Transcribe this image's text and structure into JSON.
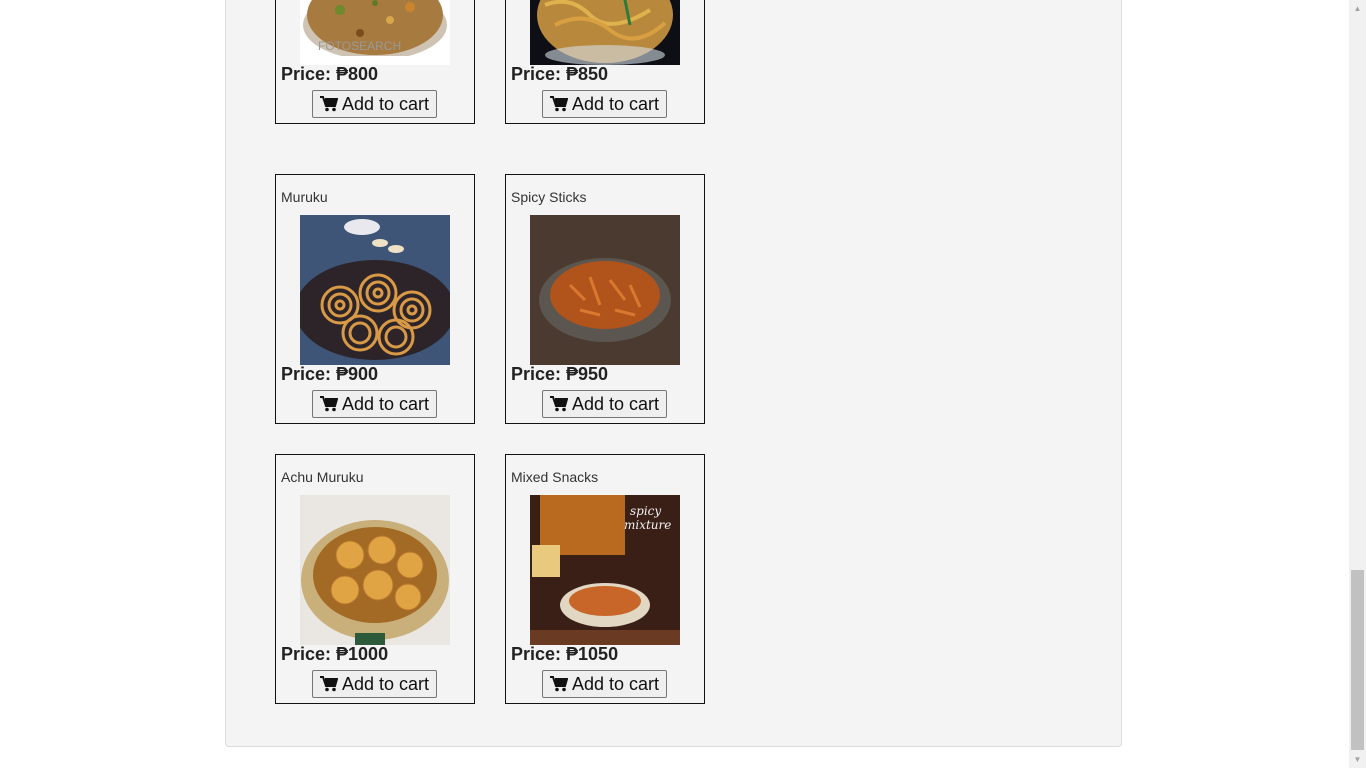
{
  "products": [
    {
      "name": "",
      "price": "Price: ₱800",
      "button": "Add to cart",
      "image": "mixture-bowl-photo"
    },
    {
      "name": "",
      "price": "Price: ₱850",
      "button": "Add to cart",
      "image": "noodle-snack-bowl-photo"
    },
    {
      "name": "Muruku",
      "price": "Price: ₱900",
      "button": "Add to cart",
      "image": "muruku-photo"
    },
    {
      "name": "Spicy Sticks",
      "price": "Price: ₱950",
      "button": "Add to cart",
      "image": "spicy-sticks-photo"
    },
    {
      "name": "Achu Muruku",
      "price": "Price: ₱1000",
      "button": "Add to cart",
      "image": "achu-muruku-photo"
    },
    {
      "name": "Mixed Snacks",
      "price": "Price: ₱1050",
      "button": "Add to cart",
      "image": "mixed-snacks-photo",
      "image_caption": "spicy mixture"
    }
  ],
  "watermark": "FOTOSEARCH",
  "icons": {
    "cart": "shopping-cart-icon"
  },
  "colors": {
    "panel_bg": "#f4f4f4",
    "card_border": "#111111",
    "button_bg": "#efefef"
  }
}
